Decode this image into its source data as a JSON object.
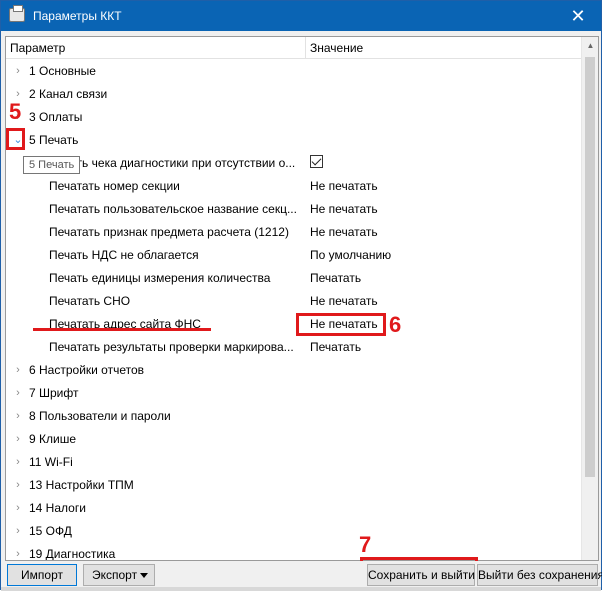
{
  "window": {
    "title": "Параметры ККТ",
    "close_glyph": "✕"
  },
  "grid": {
    "col_param": "Параметр",
    "col_value": "Значение"
  },
  "categories_top": [
    {
      "label": "1 Основные",
      "icon": "chevron-right-icon"
    },
    {
      "label": "2 Канал связи",
      "icon": "chevron-right-icon"
    },
    {
      "label": "3 Оплаты",
      "icon": "chevron-right-icon"
    },
    {
      "label": "5 Печать",
      "icon": "chevron-down-icon"
    }
  ],
  "print_items": [
    {
      "label": "Печать чека диагностики при отсутствии о...",
      "value": "",
      "checked": true
    },
    {
      "label": "Печатать номер секции",
      "value": "Не печатать"
    },
    {
      "label": "Печатать пользовательское название секц...",
      "value": "Не печатать"
    },
    {
      "label": "Печатать признак предмета расчета (1212)",
      "value": "Не печатать"
    },
    {
      "label": "Печать НДС не облагается",
      "value": "По умолчанию"
    },
    {
      "label": "Печать единицы измерения количества",
      "value": "Печатать"
    },
    {
      "label": "Печатать СНО",
      "value": "Не печатать"
    },
    {
      "label": "Печатать адрес сайта ФНС",
      "value": "Не печатать"
    },
    {
      "label": "Печатать результаты проверки маркирова...",
      "value": "Печатать"
    }
  ],
  "categories_bottom": [
    {
      "label": "6 Настройки отчетов"
    },
    {
      "label": "7 Шрифт"
    },
    {
      "label": "8 Пользователи и пароли"
    },
    {
      "label": "9 Клише"
    },
    {
      "label": "11 Wi-Fi"
    },
    {
      "label": "13 Настройки ТПМ"
    },
    {
      "label": "14 Налоги"
    },
    {
      "label": "15 ОФД"
    },
    {
      "label": "19 Диагностика"
    }
  ],
  "tooltip": "5 Печать",
  "annotations": {
    "step5": "5",
    "step6": "6",
    "step7": "7",
    "color": "#e0191b"
  },
  "buttons": {
    "import": "Импорт",
    "export": "Экспорт",
    "save_exit": "Сохранить и выйти",
    "exit_no_save": "Выйти без сохранения"
  }
}
